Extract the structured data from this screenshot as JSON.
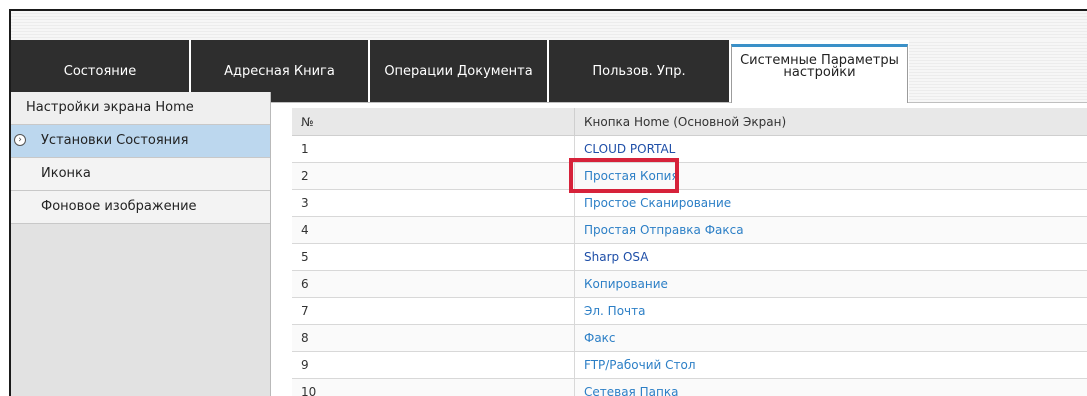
{
  "tabs": [
    {
      "label": "Состояние"
    },
    {
      "label": "Адресная Книга"
    },
    {
      "label": "Операции Документа"
    },
    {
      "label": "Пользов. Упр."
    },
    {
      "label": "Системные Параметры настройки"
    }
  ],
  "sidebar": {
    "title": "Настройки экрана Home",
    "items": [
      {
        "label": "Установки Состояния"
      },
      {
        "label": "Иконка"
      },
      {
        "label": "Фоновое изображение"
      }
    ]
  },
  "table": {
    "headers": [
      "№",
      "Кнопка Home (Основной Экран)"
    ],
    "rows": [
      {
        "num": "1",
        "name": "CLOUD PORTAL"
      },
      {
        "num": "2",
        "name": "Простая Копия"
      },
      {
        "num": "3",
        "name": "Простое Сканирование"
      },
      {
        "num": "4",
        "name": "Простая Отправка Факса"
      },
      {
        "num": "5",
        "name": "Sharp OSA"
      },
      {
        "num": "6",
        "name": "Копирование"
      },
      {
        "num": "7",
        "name": "Эл. Почта"
      },
      {
        "num": "8",
        "name": "Факс"
      },
      {
        "num": "9",
        "name": "FTP/Рабочий Стол"
      },
      {
        "num": "10",
        "name": "Сетевая Папка"
      }
    ]
  },
  "colors": {
    "accent": "#3a90c8",
    "link": "#2c7fc6",
    "highlight": "#d6223a",
    "selected": "#bcd7ee"
  }
}
